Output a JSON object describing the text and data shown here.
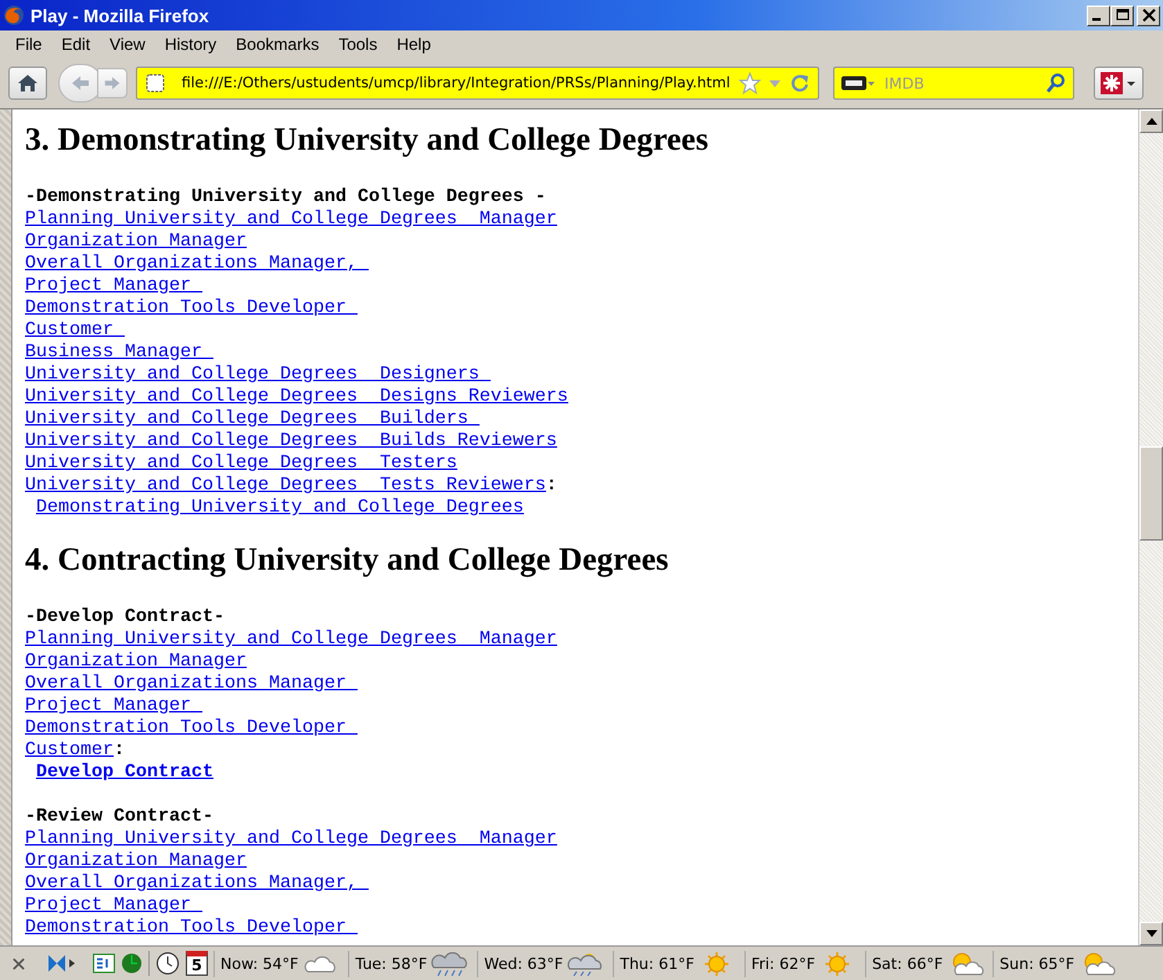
{
  "window": {
    "title": "Play - Mozilla Firefox"
  },
  "menu": [
    "File",
    "Edit",
    "View",
    "History",
    "Bookmarks",
    "Tools",
    "Help"
  ],
  "address": {
    "value": "file:///E:/Others/ustudents/umcp/library/Integration/PRSs/Planning/Play.html"
  },
  "search": {
    "placeholder": "IMDB"
  },
  "sections": [
    {
      "heading": "3. Demonstrating University and College Degrees",
      "blocks": [
        {
          "label": "-Demonstrating University and College Degrees -",
          "links": [
            "Planning University and College Degrees  Manager",
            "Organization Manager",
            "Overall Organizations Manager, ",
            "Project Manager ",
            "Demonstration Tools Developer ",
            "Customer ",
            "Business Manager ",
            "University and College Degrees  Designers ",
            "University and College Degrees  Designs Reviewers",
            "University and College Degrees  Builders ",
            "University and College Degrees  Builds Reviewers",
            "University and College Degrees  Testers",
            "University and College Degrees  Tests Reviewers"
          ],
          "suffix": ":",
          "action": {
            "text": "Demonstrating University and College Degrees",
            "bold": false
          }
        }
      ]
    },
    {
      "heading": "4. Contracting University and College Degrees",
      "blocks": [
        {
          "label": "-Develop Contract-",
          "links": [
            "Planning University and College Degrees  Manager",
            "Organization Manager",
            "Overall Organizations Manager ",
            "Project Manager ",
            "Demonstration Tools Developer ",
            "Customer"
          ],
          "suffix": ":",
          "action": {
            "text": "Develop Contract",
            "bold": true
          }
        },
        {
          "label": "-Review Contract-",
          "links": [
            "Planning University and College Degrees  Manager",
            "Organization Manager",
            "Overall Organizations Manager, ",
            "Project Manager ",
            "Demonstration Tools Developer "
          ]
        }
      ]
    }
  ],
  "weather": [
    {
      "text": "Now: 54°F",
      "kind": "cloudy"
    },
    {
      "text": "Tue: 58°F",
      "kind": "rain"
    },
    {
      "text": "Wed: 63°F",
      "kind": "showers"
    },
    {
      "text": "Thu: 61°F",
      "kind": "sunny"
    },
    {
      "text": "Fri: 62°F",
      "kind": "sunny"
    },
    {
      "text": "Sat: 66°F",
      "kind": "partly-cloudy"
    },
    {
      "text": "Sun: 65°F",
      "kind": "partly-cloudy"
    }
  ],
  "calendar": {
    "day": "5"
  }
}
